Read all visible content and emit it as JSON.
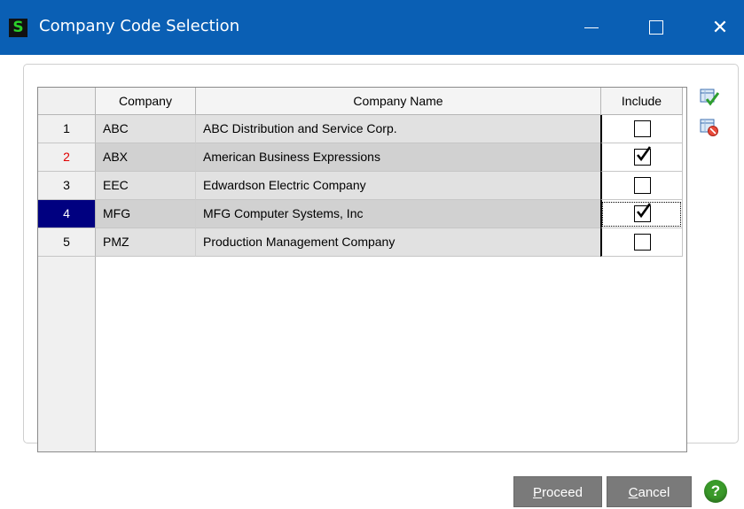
{
  "window": {
    "app_icon_glyph": "S",
    "title": "Company Code Selection",
    "titlebar_color": "#0a5fb4"
  },
  "grid": {
    "headers": {
      "company": "Company",
      "company_name": "Company Name",
      "include": "Include"
    },
    "rows": [
      {
        "num": "1",
        "code": "ABC",
        "name": "ABC Distribution and Service Corp.",
        "include": false
      },
      {
        "num": "2",
        "code": "ABX",
        "name": "American Business Expressions",
        "include": true
      },
      {
        "num": "3",
        "code": "EEC",
        "name": "Edwardson Electric Company",
        "include": false
      },
      {
        "num": "4",
        "code": "MFG",
        "name": "MFG Computer Systems, Inc",
        "include": true
      },
      {
        "num": "5",
        "code": "PMZ",
        "name": "Production Management Company",
        "include": false
      }
    ]
  },
  "side_icons": [
    "select-all-icon",
    "deselect-all-icon"
  ],
  "buttons": {
    "proceed_underline": "P",
    "proceed_rest": "roceed",
    "cancel_underline": "C",
    "cancel_rest": "ancel",
    "help_glyph": "?"
  }
}
